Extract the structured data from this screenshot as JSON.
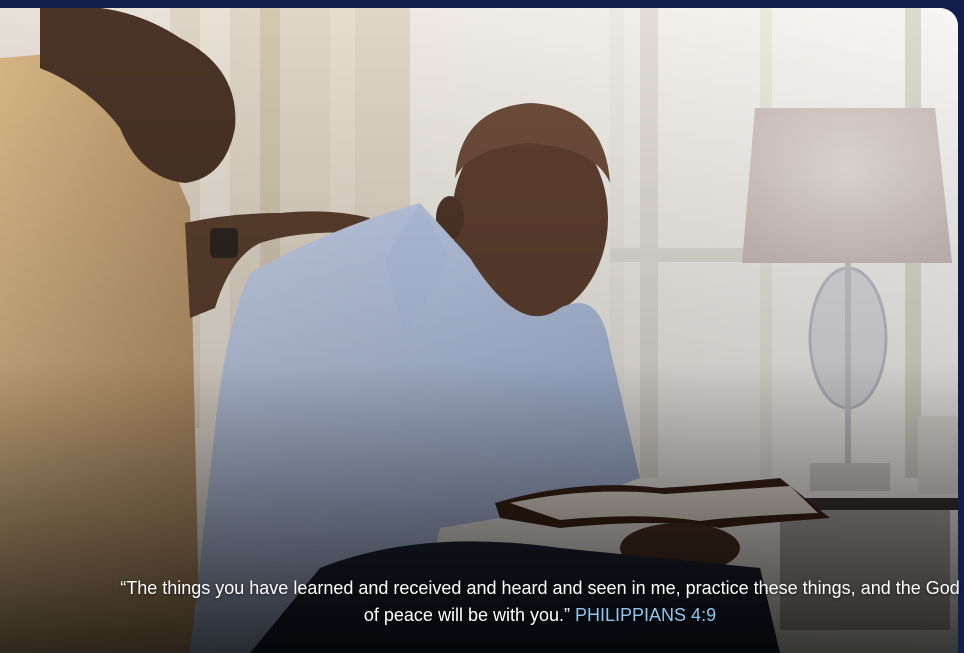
{
  "photo": {
    "icon": "photo-two-men-praying-reading-bible"
  },
  "caption": {
    "quote": "“The things you have learned and received and heard and seen in me, practice these things, and the God of peace will be with you.”",
    "reference": "PHILIPPIANS 4:9"
  },
  "colors": {
    "frame_background": "#101f4c",
    "reference_text": "#8ec7f0",
    "quote_text": "#ffffff"
  }
}
